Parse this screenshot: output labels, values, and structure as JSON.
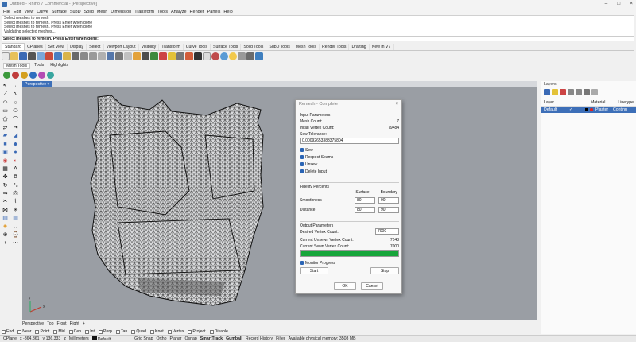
{
  "window": {
    "title": "Untitled - Rhino 7 Commercial - [Perspective]"
  },
  "menu": [
    "File",
    "Edit",
    "View",
    "Curve",
    "Surface",
    "SubD",
    "Solid",
    "Mesh",
    "Dimension",
    "Transform",
    "Tools",
    "Analyze",
    "Render",
    "Panels",
    "Help"
  ],
  "command_history": [
    "Select meshes to remesh",
    "Select meshes to remesh. Press Enter when done",
    "Select meshes to remesh. Press Enter when done",
    "Validating selected meshes..."
  ],
  "command_prompt": "Select meshes to remesh. Press Enter when done:",
  "toolbar_tabs": [
    "Standard",
    "CPlanes",
    "Set View",
    "Display",
    "Select",
    "Viewport Layout",
    "Visibility",
    "Transform",
    "Curve Tools",
    "Surface Tools",
    "Solid Tools",
    "SubD Tools",
    "Mesh Tools",
    "Render Tools",
    "Drafting",
    "New in V7"
  ],
  "sub_tabs": [
    "Mesh Tools",
    "Tools",
    "Highlights"
  ],
  "viewport": {
    "name": "Perspective",
    "menu_glyph": "▾"
  },
  "viewport_tabs": [
    "Perspective",
    "Top",
    "Front",
    "Right",
    "+"
  ],
  "axis": {
    "x": "x",
    "y": "y"
  },
  "osnaps": [
    "End",
    "Near",
    "Point",
    "Mid",
    "Cen",
    "Int",
    "Perp",
    "Tan",
    "Quad",
    "Knot",
    "Vertex",
    "Project",
    "Disable"
  ],
  "status": {
    "cplane": "CPlane",
    "x": "x -864.861",
    "y": "y 136.333",
    "z": "z",
    "units": "Millimeters",
    "layer": "Default",
    "toggles": [
      "Grid Snap",
      "Ortho",
      "Planar",
      "Osnap",
      "SmartTrack",
      "Gumball",
      "Record History",
      "Filter"
    ],
    "bold_toggles": [
      "SmartTrack",
      "Gumball"
    ],
    "memory": "Available physical memory: 3508 MB"
  },
  "layers_panel": {
    "title": "Layers",
    "columns": [
      "Layer",
      "Material",
      "Linetype"
    ],
    "rows": [
      {
        "name": "Default",
        "check": "✓",
        "linetype": "Continu",
        "material": "Plaster"
      }
    ]
  },
  "dialog": {
    "title": "Remesh - Complete",
    "close": "×",
    "input_header": "Input Parameters",
    "mesh_count_label": "Mesh Count:",
    "mesh_count": "7",
    "initial_vertex_label": "Initial Vertex Count:",
    "initial_vertex": "79484",
    "sew_tol_label": "Sew Tolerance:",
    "sew_tol": "0.00092653383375804",
    "checks": [
      "Sew",
      "Respect Seams",
      "Unsew",
      "Delete Input"
    ],
    "fidelity_header": "Fidelity Percents",
    "col_surface": "Surface",
    "col_boundary": "Boundary",
    "smoothness_label": "Smoothness",
    "smoothness": [
      "80",
      "90"
    ],
    "distance_label": "Distance",
    "distance": [
      "80",
      "90"
    ],
    "output_header": "Output Parameters",
    "desired_label": "Desired Vertex Count:",
    "desired": "7000",
    "current_unsewn_label": "Current Unsewn Vertex Count:",
    "current_unsewn": "7143",
    "current_sewn_label": "Current Sewn Vertex Count:",
    "current_sewn": "7000",
    "progress": 1.0,
    "monitor_label": "Monitor Progress",
    "start": "Start",
    "stop": "Stop",
    "ok": "OK",
    "cancel": "Cancel"
  },
  "colors": {
    "accent": "#3d6fb8",
    "progress": "#17a53a",
    "viewport_bg": "#9a9ea4"
  }
}
